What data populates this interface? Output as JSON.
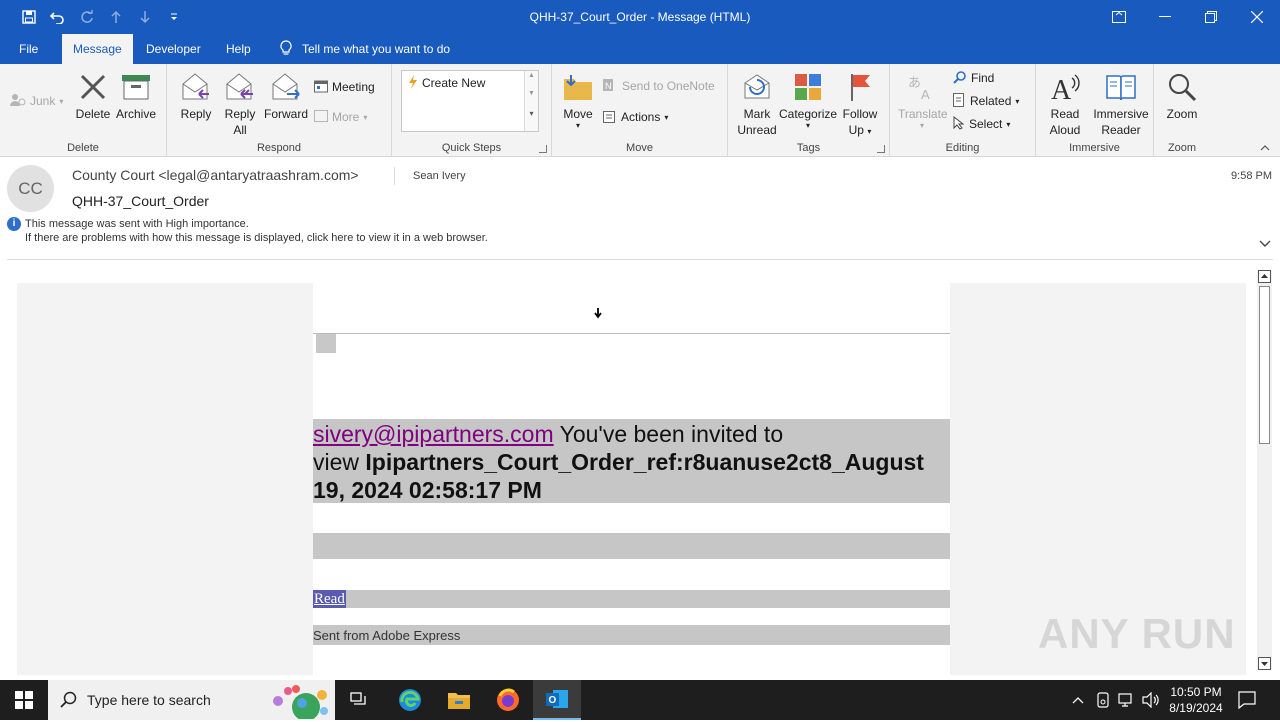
{
  "window": {
    "title": "QHH-37_Court_Order  -  Message (HTML)"
  },
  "menu": {
    "file": "File",
    "message": "Message",
    "developer": "Developer",
    "help": "Help",
    "tell_me": "Tell me what you want to do"
  },
  "ribbon": {
    "delete_group": {
      "label": "Delete",
      "junk": "Junk",
      "delete": "Delete",
      "archive": "Archive"
    },
    "respond_group": {
      "label": "Respond",
      "reply": "Reply",
      "reply_all_1": "Reply",
      "reply_all_2": "All",
      "forward": "Forward",
      "meeting": "Meeting",
      "more": "More"
    },
    "quick_steps_group": {
      "label": "Quick Steps",
      "create_new": "Create New"
    },
    "move_group": {
      "label": "Move",
      "move": "Move",
      "send_onenote": "Send to OneNote",
      "actions": "Actions"
    },
    "tags_group": {
      "label": "Tags",
      "mark_unread_1": "Mark",
      "mark_unread_2": "Unread",
      "categorize": "Categorize",
      "follow_up_1": "Follow",
      "follow_up_2": "Up"
    },
    "editing_group": {
      "label": "Editing",
      "translate": "Translate",
      "find": "Find",
      "related": "Related",
      "select": "Select"
    },
    "immersive_group": {
      "label": "Immersive",
      "read_aloud_1": "Read",
      "read_aloud_2": "Aloud",
      "immersive_reader_1": "Immersive",
      "immersive_reader_2": "Reader"
    },
    "zoom_group": {
      "label": "Zoom",
      "zoom": "Zoom"
    }
  },
  "message": {
    "avatar_initials": "CC",
    "from": "County Court <legal@antaryatraashram.com>",
    "to": "Sean Ivery",
    "subject": "QHH-37_Court_Order",
    "time": "9:58 PM",
    "info_line_1": "This message was sent with High importance.",
    "info_line_2": "If there are problems with how this message is displayed, click here to view it in a web browser."
  },
  "body": {
    "email_link": "sivery@ipipartners.com",
    "invite_text_1": " You've been invited to",
    "invite_text_2": "view ",
    "doc_name_1": "Ipipartners_Court_Order_ref:r8uanuse2ct8_August",
    "doc_name_2": "19, 2024 02:58:17 PM",
    "read_link": "Read",
    "footer": "Sent from Adobe Express"
  },
  "watermark": "ANY RUN",
  "taskbar": {
    "search_placeholder": "Type here to search",
    "time": "10:50 PM",
    "date": "8/19/2024"
  },
  "colors": {
    "brand": "#185abd",
    "highlight_gray": "#c6c6c6",
    "link_purple": "#800080",
    "read_link": "#3b3bb3"
  }
}
